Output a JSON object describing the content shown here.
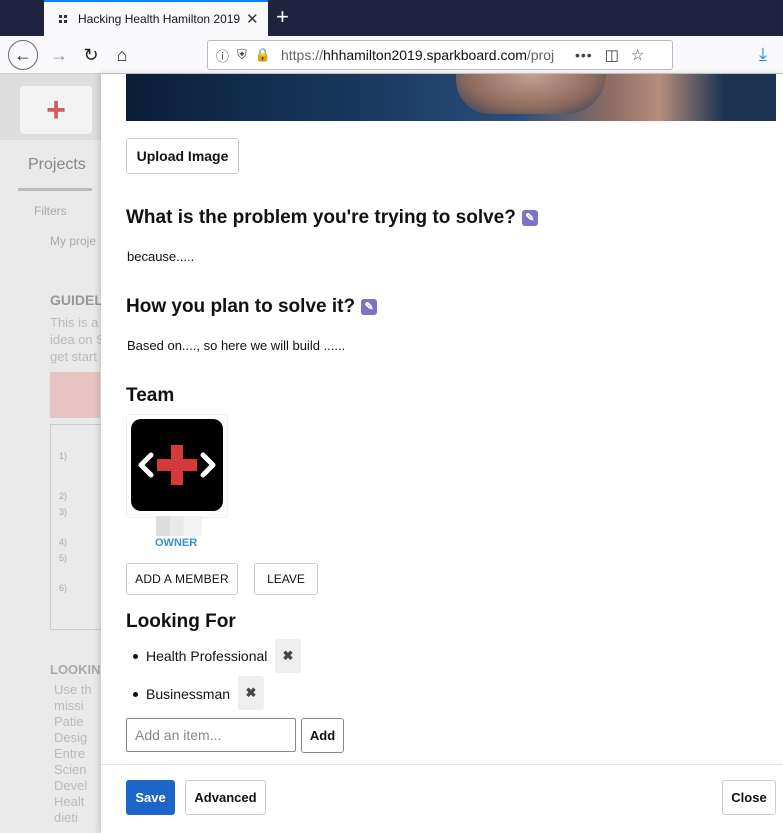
{
  "browser": {
    "tab_title": "Hacking Health Hamilton 2019",
    "tab_close": "✕",
    "new_tab": "+",
    "url_prefix": "https://",
    "url_domain": "hhhamilton2019.sparkboard.com",
    "url_path": "/proj",
    "more_actions": "•••"
  },
  "background": {
    "projects_tab": "Projects",
    "filters": "Filters",
    "my_projects": "My proje",
    "guide_title": "GUIDEL",
    "guide_text": "This is a\nidea on S\nget start",
    "list_numbers": [
      "1)",
      "2)",
      "3)",
      "4)",
      "5)",
      "6)"
    ],
    "looking_title": "LOOKIN",
    "looking_items": [
      "Use th",
      "missi",
      "Patie",
      "Desig",
      "Entre",
      "Scien",
      "Devel",
      "Healt",
      "dieti"
    ]
  },
  "editor": {
    "upload_image": "Upload Image",
    "problem_heading": "What is the problem you're trying to solve?",
    "problem_text": "because.....",
    "solution_heading": "How you plan to solve it?",
    "solution_text": "Based on...., so here we will build ......",
    "team_heading": "Team",
    "owner_label": "OWNER",
    "add_member": "ADD A MEMBER",
    "leave": "LEAVE",
    "looking_for_heading": "Looking For",
    "looking_for_items": [
      "Health Professional",
      "Businessman"
    ],
    "remove_symbol": "✖",
    "add_item_placeholder": "Add an item...",
    "add_button": "Add",
    "save": "Save",
    "advanced": "Advanced",
    "close": "Close"
  },
  "colors": {
    "primary_button": "#1d66c7",
    "edit_icon": "#7c73c9",
    "owner_label": "#3a90c9",
    "tab_bar": "#202340"
  }
}
